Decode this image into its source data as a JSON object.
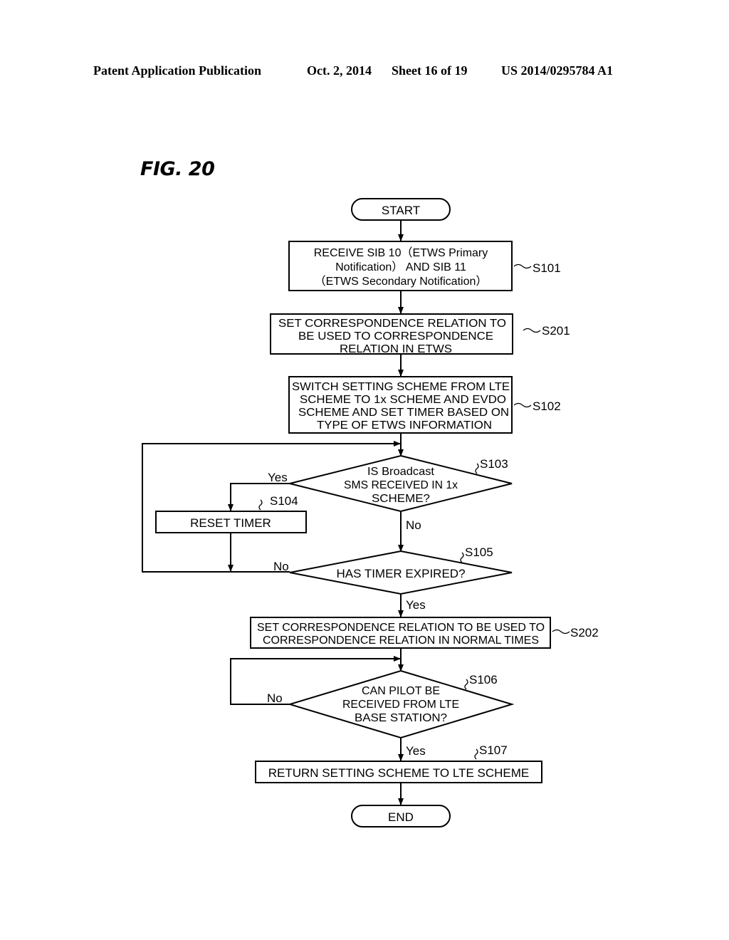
{
  "header": {
    "publication": "Patent Application Publication",
    "date": "Oct. 2, 2014",
    "sheet": "Sheet 16 of 19",
    "number": "US 2014/0295784 A1"
  },
  "figure": {
    "title": "FIG. 20"
  },
  "flowchart": {
    "start": "START",
    "end": "END",
    "s101": {
      "id": "S101",
      "lines": [
        "RECEIVE SIB 10（ETWS Primary",
        "Notification） AND SIB 11",
        "（ETWS Secondary Notification）"
      ]
    },
    "s201": {
      "id": "S201",
      "lines": [
        "SET CORRESPONDENCE RELATION TO",
        "BE USED TO CORRESPONDENCE",
        "RELATION IN ETWS"
      ]
    },
    "s102": {
      "id": "S102",
      "lines": [
        "SWITCH SETTING SCHEME FROM LTE",
        "SCHEME TO 1x SCHEME AND EVDO",
        "SCHEME AND SET TIMER BASED ON",
        "TYPE OF ETWS INFORMATION"
      ]
    },
    "s103": {
      "id": "S103",
      "lines": [
        "IS Broadcast",
        "SMS RECEIVED IN 1x",
        "SCHEME?"
      ],
      "yes": "Yes",
      "no": "No"
    },
    "s104": {
      "id": "S104",
      "lines": [
        "RESET TIMER"
      ]
    },
    "s105": {
      "id": "S105",
      "lines": [
        "HAS TIMER EXPIRED?"
      ],
      "yes": "Yes",
      "no": "No"
    },
    "s202": {
      "id": "S202",
      "lines": [
        "SET CORRESPONDENCE RELATION TO BE USED TO",
        "CORRESPONDENCE RELATION IN NORMAL TIMES"
      ]
    },
    "s106": {
      "id": "S106",
      "lines": [
        "CAN PILOT BE",
        "RECEIVED FROM LTE",
        "BASE STATION?"
      ],
      "yes": "Yes",
      "no": "No"
    },
    "s107": {
      "id": "S107",
      "lines": [
        "RETURN SETTING SCHEME TO LTE SCHEME"
      ]
    }
  }
}
